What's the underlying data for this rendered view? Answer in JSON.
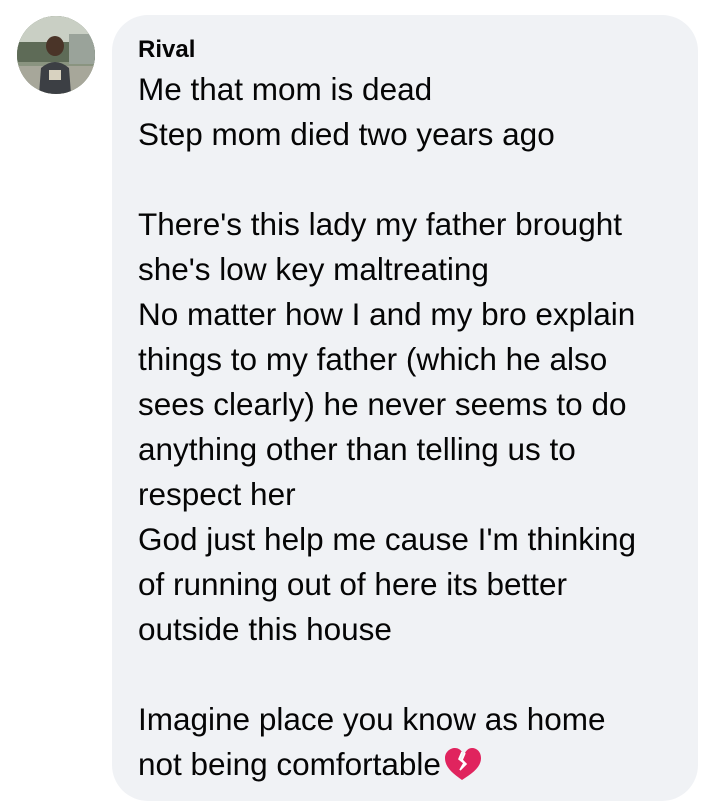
{
  "comment": {
    "author": "Rival",
    "avatar_icon": "profile-photo",
    "lines": [
      "Me that mom is dead",
      "Step mom died two years ago",
      "",
      "There's this lady my father brought",
      "she's low key maltreating",
      "No matter how I and my bro explain",
      "things to my father (which he also",
      "sees clearly) he never seems to do",
      "anything other than telling us to",
      "respect her",
      "God just help me cause I'm thinking",
      "of running out of here its better",
      "outside this house",
      "",
      "Imagine place you know as home",
      "not being comfortable"
    ],
    "trailing_emoji": "broken-heart-icon",
    "colors": {
      "bubble_background": "#f0f2f5",
      "text": "#050505",
      "heart": "#e0245e"
    }
  }
}
